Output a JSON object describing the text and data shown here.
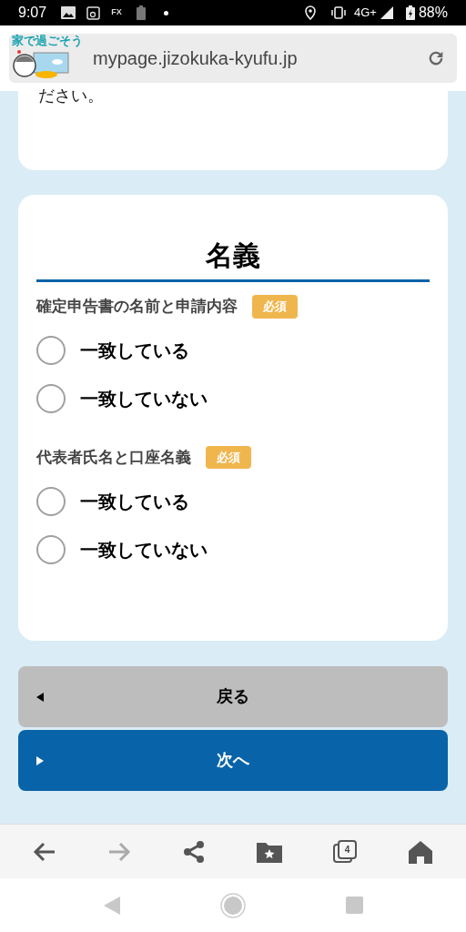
{
  "status_bar": {
    "time": "9:07",
    "fx_label": "FX",
    "network": "4G+",
    "battery": "88%"
  },
  "browser": {
    "logo_text": "家で過ごそう",
    "url": "mypage.jizokuka-kyufu.jp"
  },
  "previous_card": {
    "text_tail": "ださい。"
  },
  "section": {
    "title": "名義",
    "questions": [
      {
        "label": "確定申告書の名前と申請内容",
        "badge": "必須",
        "options": [
          {
            "label": "一致している",
            "selected": false
          },
          {
            "label": "一致していない",
            "selected": false
          }
        ]
      },
      {
        "label": "代表者氏名と口座名義",
        "badge": "必須",
        "options": [
          {
            "label": "一致している",
            "selected": false
          },
          {
            "label": "一致していない",
            "selected": false
          }
        ]
      }
    ]
  },
  "buttons": [
    {
      "kind": "back",
      "label": "戻る"
    },
    {
      "kind": "next",
      "label": "次へ"
    }
  ],
  "toolbar": {
    "forward_disabled": true,
    "tab_count": "4"
  }
}
